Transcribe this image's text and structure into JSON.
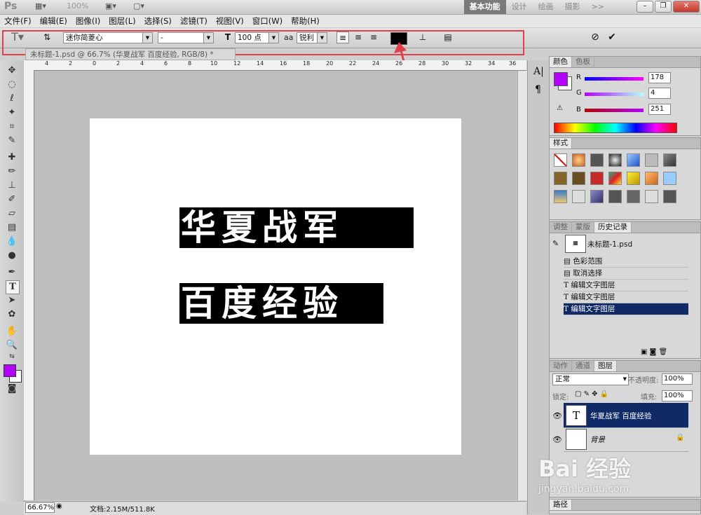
{
  "titlebar": {
    "app_logo": "Ps",
    "zoom": "100%",
    "workspaces": [
      "基本功能",
      "设计",
      "绘画",
      "摄影"
    ],
    "more": ">>"
  },
  "menu": [
    "文件(F)",
    "编辑(E)",
    "图像(I)",
    "图层(L)",
    "选择(S)",
    "滤镜(T)",
    "视图(V)",
    "窗口(W)",
    "帮助(H)"
  ],
  "options": {
    "font_family": "迷你简菱心",
    "font_style": "-",
    "font_size": "100 点",
    "anti_alias_label": "aa",
    "anti_alias": "锐利",
    "text_color": "#000000",
    "cancel_icon": "cancel-icon",
    "commit_icon": "check-icon"
  },
  "document": {
    "tab_title": "未标题-1.psd @ 66.7% (华夏战军 百度经验, RGB/8) *",
    "text_line1": "华夏战军",
    "text_line2": "百度经验"
  },
  "ruler": {
    "h_ticks": [
      "4",
      "2",
      "0",
      "2",
      "4",
      "6",
      "8",
      "10",
      "12",
      "14",
      "16",
      "18",
      "20",
      "22",
      "24",
      "26",
      "28",
      "30",
      "32",
      "34",
      "36"
    ]
  },
  "status": {
    "zoom": "66.67%",
    "doc_size": "文档:2.15M/511.8K"
  },
  "color_panel": {
    "tabs": [
      "颜色",
      "色板"
    ],
    "r_label": "R",
    "r": "178",
    "g_label": "G",
    "g": "4",
    "b_label": "B",
    "b": "251",
    "fg_color": "#b204fb"
  },
  "styles_panel": {
    "tabs": [
      "样式"
    ]
  },
  "history_panel": {
    "tabs": [
      "调整",
      "蒙版",
      "历史记录"
    ],
    "snapshot": "未标题-1.psd",
    "items": [
      "色彩范围",
      "取消选择",
      "编辑文字图层",
      "编辑文字图层",
      "编辑文字图层"
    ]
  },
  "layers_panel": {
    "tabs": [
      "动作",
      "通道",
      "图层"
    ],
    "blend_mode": "正常",
    "opacity_label": "不透明度:",
    "opacity": "100%",
    "lock_label": "锁定:",
    "fill_label": "填充:",
    "fill": "100%",
    "layers": [
      {
        "name": "华夏战军 百度经验",
        "thumb": "T"
      },
      {
        "name": "背景",
        "thumb": ""
      }
    ]
  },
  "paths_panel": {
    "tab": "路径"
  },
  "watermark": {
    "brand": "Bai 经验",
    "url": "jingyan.baidu.com"
  }
}
